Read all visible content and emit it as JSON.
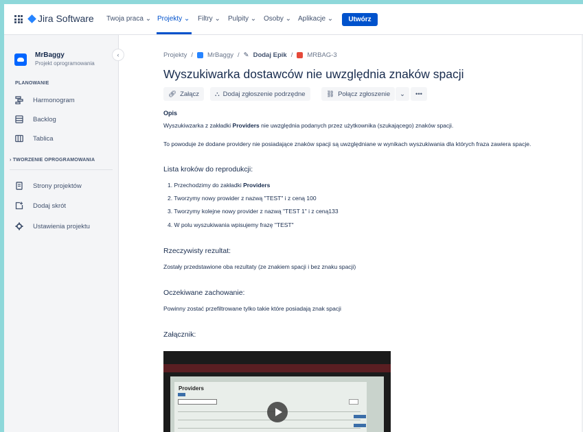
{
  "topnav": {
    "logo_text": "Jira Software",
    "items": [
      {
        "label": "Twoja praca ⌄"
      },
      {
        "label": "Projekty ⌄"
      },
      {
        "label": "Filtry ⌄"
      },
      {
        "label": "Pulpity ⌄"
      },
      {
        "label": "Osoby ⌄"
      },
      {
        "label": "Aplikacje ⌄"
      }
    ],
    "create_label": "Utwórz"
  },
  "sidebar": {
    "project_name": "MrBaggy",
    "project_type": "Projekt oprogramowania",
    "planning_title": "PLANOWANIE",
    "planning_items": [
      {
        "label": "Harmonogram",
        "icon": "roadmap-icon"
      },
      {
        "label": "Backlog",
        "icon": "backlog-icon"
      },
      {
        "label": "Tablica",
        "icon": "board-icon"
      }
    ],
    "dev_title": "TWORZENIE OPROGRAMOWANIA",
    "other_items": [
      {
        "label": "Strony projektów",
        "icon": "pages-icon"
      },
      {
        "label": "Dodaj skrót",
        "icon": "add-shortcut-icon"
      },
      {
        "label": "Ustawienia projektu",
        "icon": "gear-icon"
      }
    ]
  },
  "breadcrumb": {
    "projects": "Projekty",
    "project": "MrBaggy",
    "epic": "Dodaj Epik",
    "issue": "MRBAG-3"
  },
  "issue": {
    "title": "Wyszukiwarka dostawców nie uwzględnia znaków spacji",
    "toolbar": {
      "attach": "Załącz",
      "subtask": "Dodaj zgłoszenie podrzędne",
      "link": "Połącz zgłoszenie",
      "more": "•••"
    },
    "description_label": "Opis",
    "desc_line1_a": "Wyszukiwzarka z zakładki ",
    "desc_line1_b": "Providers",
    "desc_line1_c": " nie uwzględnia podanych przez użytkownika (szukającego) znaków spacji.",
    "desc_line2": "To powoduje że dodane providery nie posiadające znaków spacji są uwzględniane w wynikach wyszukiwania  dla których fraza zawiera spacje.",
    "steps_heading": "Lista kroków do reprodukcji:",
    "step1_a": "1. Przechodzimy do zakładki ",
    "step1_b": "Providers",
    "step2": "2. Tworzymy nowy prowider z nazwą \"TEST\" i z ceną 100",
    "step3": "3. Tworzymy kolejne nowy provider z nazwą \"TEST 1\" i z ceną133",
    "step4": "4. W polu wyszukiwania wpisujemy frazę \"TEST\"",
    "actual_heading": "Rzeczywisty rezultat:",
    "actual_text": "Zostały przedstawione oba rezultaty (ze znakiem spacji i bez znaku spacji)",
    "expected_heading": "Oczekiwane zachowanie:",
    "expected_text": "Powinny zostać przefiltrowane tylko takie które posiadają znak spacji",
    "attachment_heading": "Załącznik:",
    "attachment_page_title": "Providers"
  },
  "colors": {
    "accent": "#0052cc",
    "epic": "#6554c0",
    "bug": "#e5493a"
  }
}
